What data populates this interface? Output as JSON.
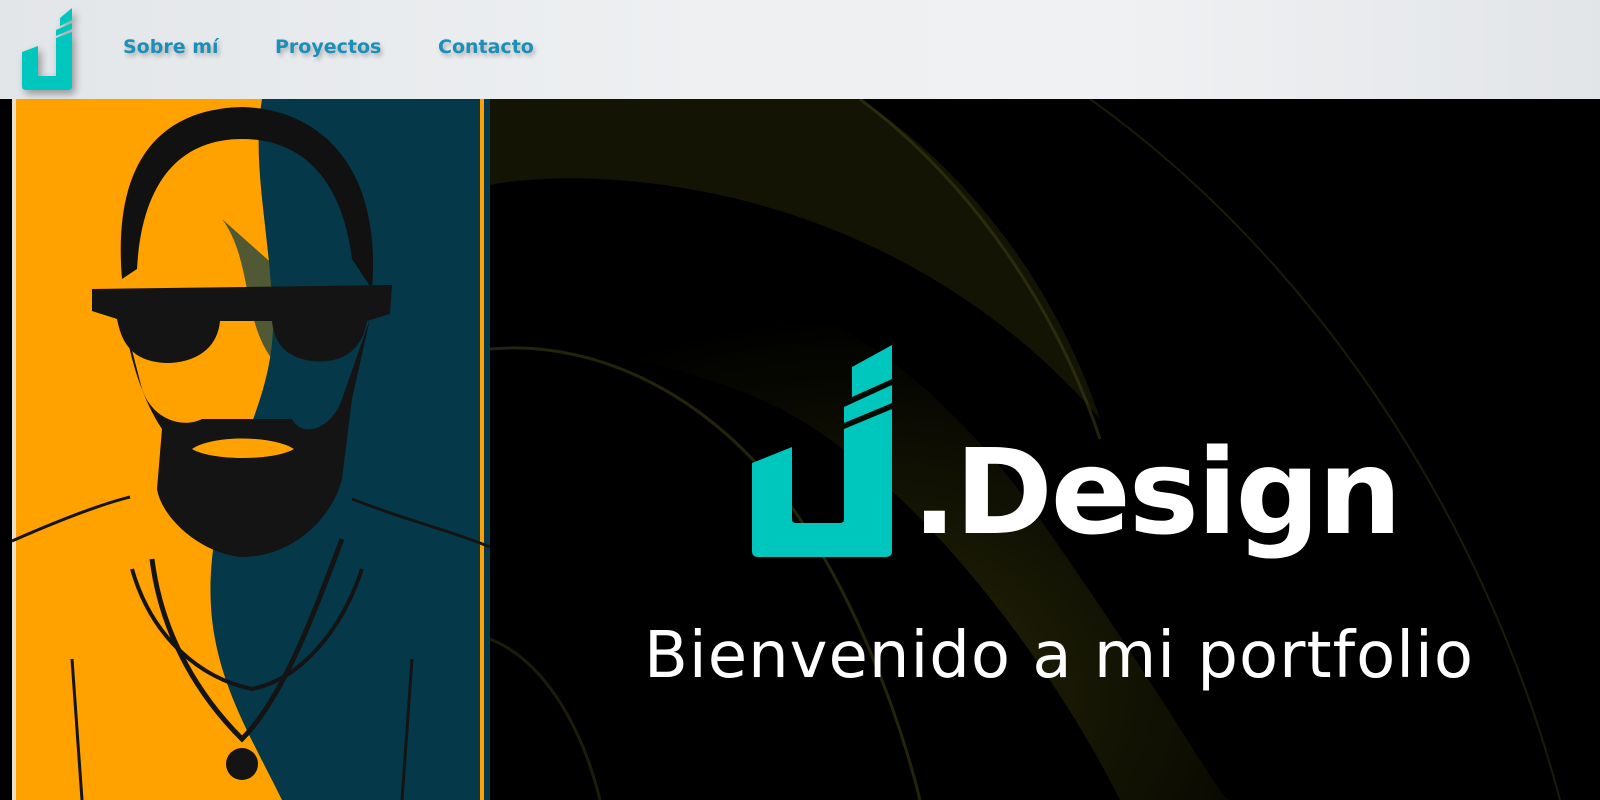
{
  "nav": {
    "links": [
      {
        "label": "Sobre mí"
      },
      {
        "label": "Proyectos"
      },
      {
        "label": "Contacto"
      }
    ]
  },
  "hero": {
    "brand_text": ".Design",
    "tagline": "Bienvenido a mi portfolio"
  },
  "colors": {
    "accent": "#00c7be",
    "link": "#1b8fb8",
    "portrait_orange": "#ffa200",
    "portrait_teal": "#05394a",
    "hero_bg": "#000000"
  },
  "icons": [
    "logo-icon",
    "brand-logo-icon"
  ]
}
